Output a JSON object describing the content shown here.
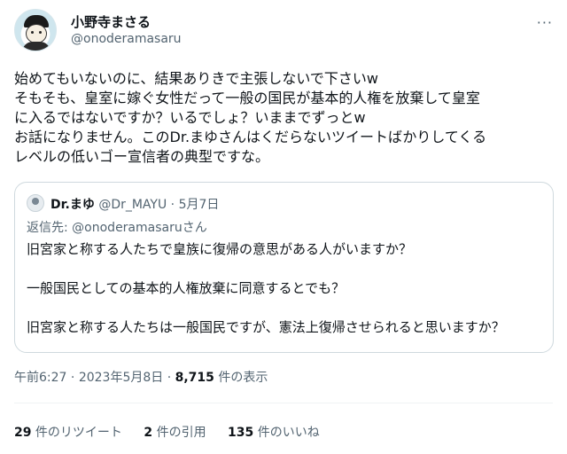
{
  "author": {
    "name": "小野寺まさる",
    "handle": "@onoderamasaru",
    "more_icon": "ellipsis-icon"
  },
  "tweet": {
    "lines": [
      "始めてもいないのに、結果ありきで主張しないで下さいw",
      "そもそも、皇室に嫁ぐ女性だって一般の国民が基本的人権を放棄して皇室",
      "に入るではないですか？いるでしょ？いままでずっとw",
      "お話になりません。このDr.まゆさんはくだらないツイートばかりしてくる",
      "レベルの低いゴー宣信者の典型ですな。"
    ]
  },
  "quote": {
    "name": "Dr.まゆ",
    "handle": "@Dr_MAYU",
    "separator": " · ",
    "date": "5月7日",
    "reply_prefix": "返信先: ",
    "reply_to": "@onoderamasaruさん",
    "lines": [
      "旧宮家と称する人たちで皇族に復帰の意思がある人がいますか？",
      "",
      "一般国民としての基本的人権放棄に同意するとでも？",
      "",
      "旧宮家と称する人たちは一般国民ですが、憲法上復帰させられると思いますか？"
    ]
  },
  "meta": {
    "time": "午前6:27",
    "separator": " · ",
    "date": "2023年5月8日",
    "views": "8,715",
    "views_label": " 件の表示"
  },
  "stats": {
    "retweets": "29",
    "retweets_label": " 件のリツイート",
    "quotes": "2",
    "quotes_label": " 件の引用",
    "likes": "135",
    "likes_label": " 件のいいね"
  },
  "colors": {
    "text": "#0f1419",
    "secondary": "#536471",
    "border": "#cfd9de"
  }
}
